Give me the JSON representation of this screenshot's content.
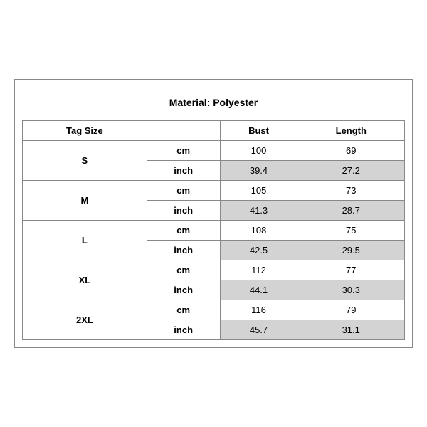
{
  "title": "Material: Polyester",
  "columns": {
    "tag_size": "Tag Size",
    "bust": "Bust",
    "length": "Length"
  },
  "rows": [
    {
      "size": "S",
      "cm_bust": "100",
      "cm_length": "69",
      "inch_bust": "39.4",
      "inch_length": "27.2"
    },
    {
      "size": "M",
      "cm_bust": "105",
      "cm_length": "73",
      "inch_bust": "41.3",
      "inch_length": "28.7"
    },
    {
      "size": "L",
      "cm_bust": "108",
      "cm_length": "75",
      "inch_bust": "42.5",
      "inch_length": "29.5"
    },
    {
      "size": "XL",
      "cm_bust": "112",
      "cm_length": "77",
      "inch_bust": "44.1",
      "inch_length": "30.3"
    },
    {
      "size": "2XL",
      "cm_bust": "116",
      "cm_length": "79",
      "inch_bust": "45.7",
      "inch_length": "31.1"
    }
  ],
  "unit_cm": "cm",
  "unit_inch": "inch"
}
